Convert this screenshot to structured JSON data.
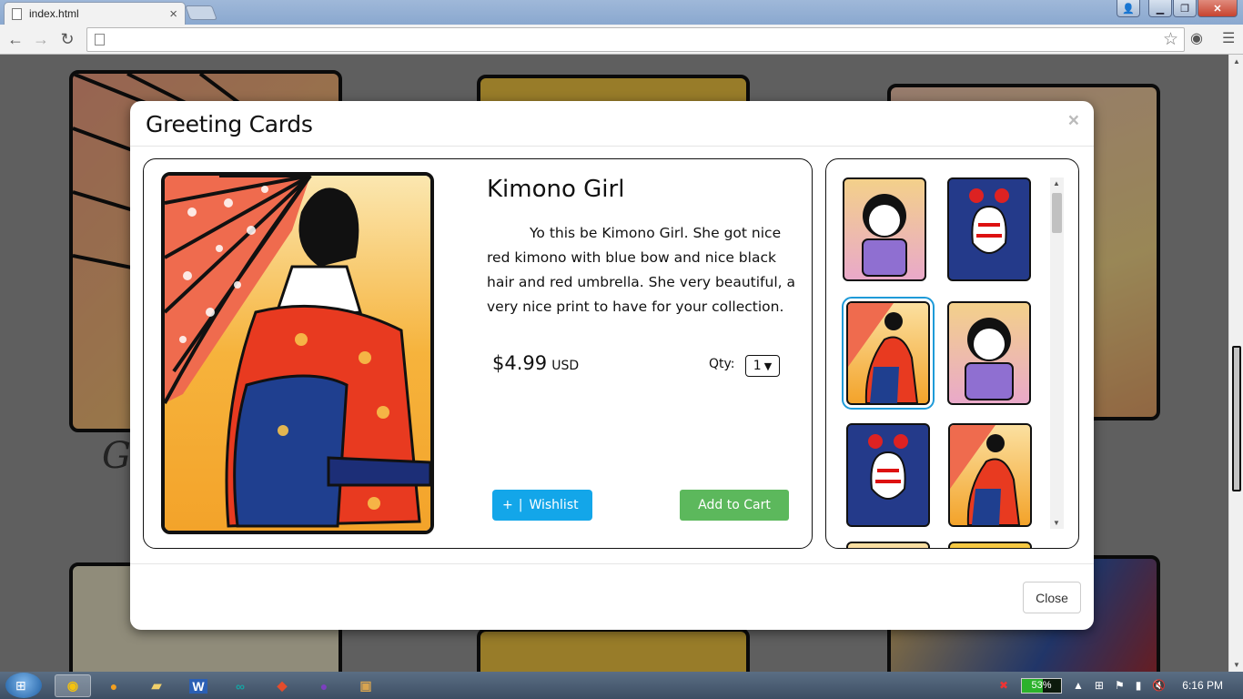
{
  "browser": {
    "tab_title": "index.html",
    "tab_close": "×",
    "address": "",
    "window_buttons": {
      "minimize": "▁",
      "maximize": "❐",
      "close": "✕"
    }
  },
  "modal": {
    "title": "Greeting Cards",
    "close_x": "×",
    "product": {
      "name": "Kimono Girl",
      "description": "Yo this be Kimono Girl.  She got nice red kimono with blue bow and nice black hair and red umbrella.  She very beautiful, a very nice print to have for your collection.",
      "price": "$4.99",
      "currency": "USD",
      "qty_label": "Qty:",
      "qty_value": "1",
      "wishlist_plus": "+",
      "wishlist_label": "Wishlist",
      "add_to_cart_label": "Add to Cart"
    },
    "thumbnails": [
      {
        "name": "chibi-girl",
        "selected": false
      },
      {
        "name": "kabuki-mask",
        "selected": false
      },
      {
        "name": "kimono-girl",
        "selected": true
      },
      {
        "name": "chibi-girl",
        "selected": false
      },
      {
        "name": "kabuki-mask",
        "selected": false
      },
      {
        "name": "kimono-girl",
        "selected": false
      }
    ],
    "footer_close_label": "Close"
  },
  "background": {
    "partial_text": "Gr"
  },
  "taskbar": {
    "battery": "53%",
    "clock": "6:16 PM"
  },
  "colors": {
    "wishlist_blue": "#13a6e9",
    "cart_green": "#5cb85c",
    "selected_outline": "#1e9ad8"
  }
}
